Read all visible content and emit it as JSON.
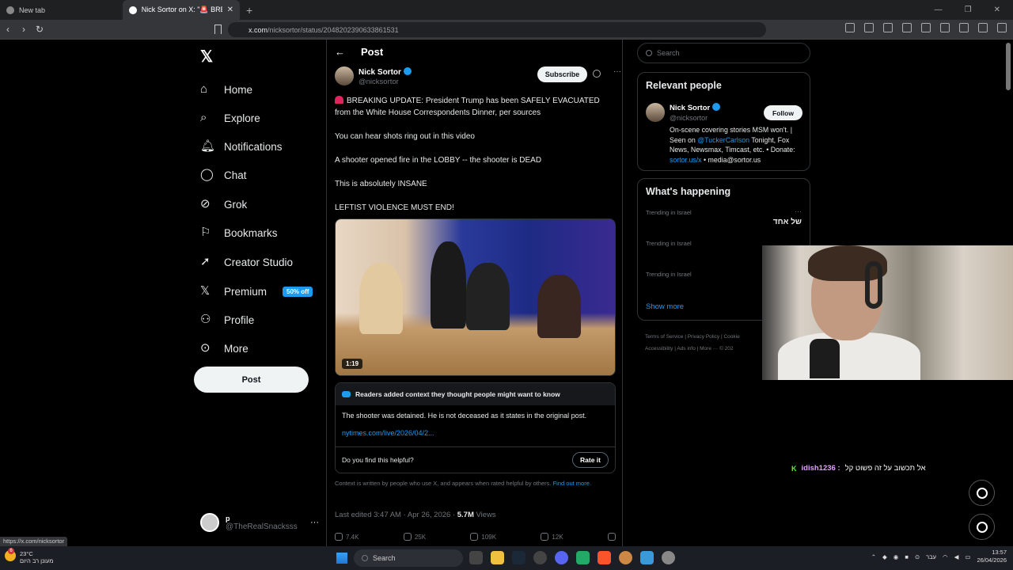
{
  "browser": {
    "tabs": [
      {
        "title": "New tab",
        "active": false
      },
      {
        "title": "Nick Sortor on X: \"🚨 BREAKING",
        "active": true
      }
    ],
    "url_host": "x.com",
    "url_path": "/nicksortor/status/2048202390633861531",
    "status_url": "https://x.com/nicksortor"
  },
  "nav": {
    "items": [
      {
        "label": "Home",
        "icon": "home-icon"
      },
      {
        "label": "Explore",
        "icon": "search-icon"
      },
      {
        "label": "Notifications",
        "icon": "bell-icon"
      },
      {
        "label": "Chat",
        "icon": "chat-icon"
      },
      {
        "label": "Grok",
        "icon": "grok-icon"
      },
      {
        "label": "Bookmarks",
        "icon": "bookmark-icon"
      },
      {
        "label": "Creator Studio",
        "icon": "rocket-icon"
      },
      {
        "label": "Premium",
        "icon": "x-icon"
      },
      {
        "label": "Profile",
        "icon": "person-icon"
      },
      {
        "label": "More",
        "icon": "more-circle-icon"
      }
    ],
    "premium_badge": "50% off",
    "post_button": "Post",
    "account": {
      "name": "p",
      "handle": "@TheRealSnacksss"
    }
  },
  "post": {
    "header_title": "Post",
    "author_name": "Nick Sortor",
    "author_handle": "@nicksortor",
    "subscribe_label": "Subscribe",
    "paragraphs": [
      "BREAKING UPDATE: President Trump has been SAFELY EVACUATED from the White House Correspondents Dinner, per sources",
      "You can hear shots ring out in this video",
      "A shooter opened fire in the LOBBY -- the shooter is DEAD",
      "This is absolutely INSANE",
      "LEFTIST VIOLENCE MUST END!"
    ],
    "video_duration": "1:19",
    "community_note": {
      "header": "Readers added context they thought people might want to know",
      "body": "The shooter was detained. He is not deceased as it states in the original post.",
      "link": "nytimes.com/live/2026/04/2...",
      "question": "Do you find this helpful?",
      "rate_label": "Rate it"
    },
    "disclaimer": "Context is written by people who use X, and appears when rated helpful by others.",
    "disclaimer_link": "Find out more.",
    "edited": "Last edited 3:47 AM · Apr 26, 2026 ·",
    "views_count": "5.7M",
    "views_label": "Views",
    "actions": {
      "replies": "7.4K",
      "reposts": "25K",
      "likes": "109K",
      "bookmarks": "12K"
    }
  },
  "sidebar": {
    "search_placeholder": "Search",
    "relevant_title": "Relevant people",
    "person": {
      "name": "Nick Sortor",
      "handle": "@nicksortor",
      "follow_label": "Follow",
      "bio_1": "On-scene covering stories MSM won't. | Seen on ",
      "bio_link1": "@TuckerCarlson",
      "bio_2": " Tonight, Fox News, Newsmax, Timcast, etc. • Donate: ",
      "bio_link2": "sortor.us/x",
      "bio_3": " • media@sortor.us"
    },
    "happening_title": "What's happening",
    "trends": [
      {
        "context": "Trending in Israel",
        "name": "של אחד"
      },
      {
        "context": "Trending in Israel",
        "name": ""
      },
      {
        "context": "Trending in Israel",
        "name": ""
      }
    ],
    "show_more": "Show more",
    "footer_1": "Terms of Service  |  Privacy Policy  |  Cookie",
    "footer_2": "Accessibility  |  Ads info  |  More ···  © 202"
  },
  "chat": {
    "username": "idish1236 :",
    "message": "אל תכשוב על זה פשוט קל"
  },
  "taskbar": {
    "temperature": "23°C",
    "weather_text": "מעונן רב היום",
    "weather_badge": "6",
    "search_label": "Search",
    "lang": "עבר",
    "time": "13:57",
    "date": "26/04/2026"
  },
  "colors": {
    "accent": "#1d9bf0",
    "background": "#000000"
  }
}
